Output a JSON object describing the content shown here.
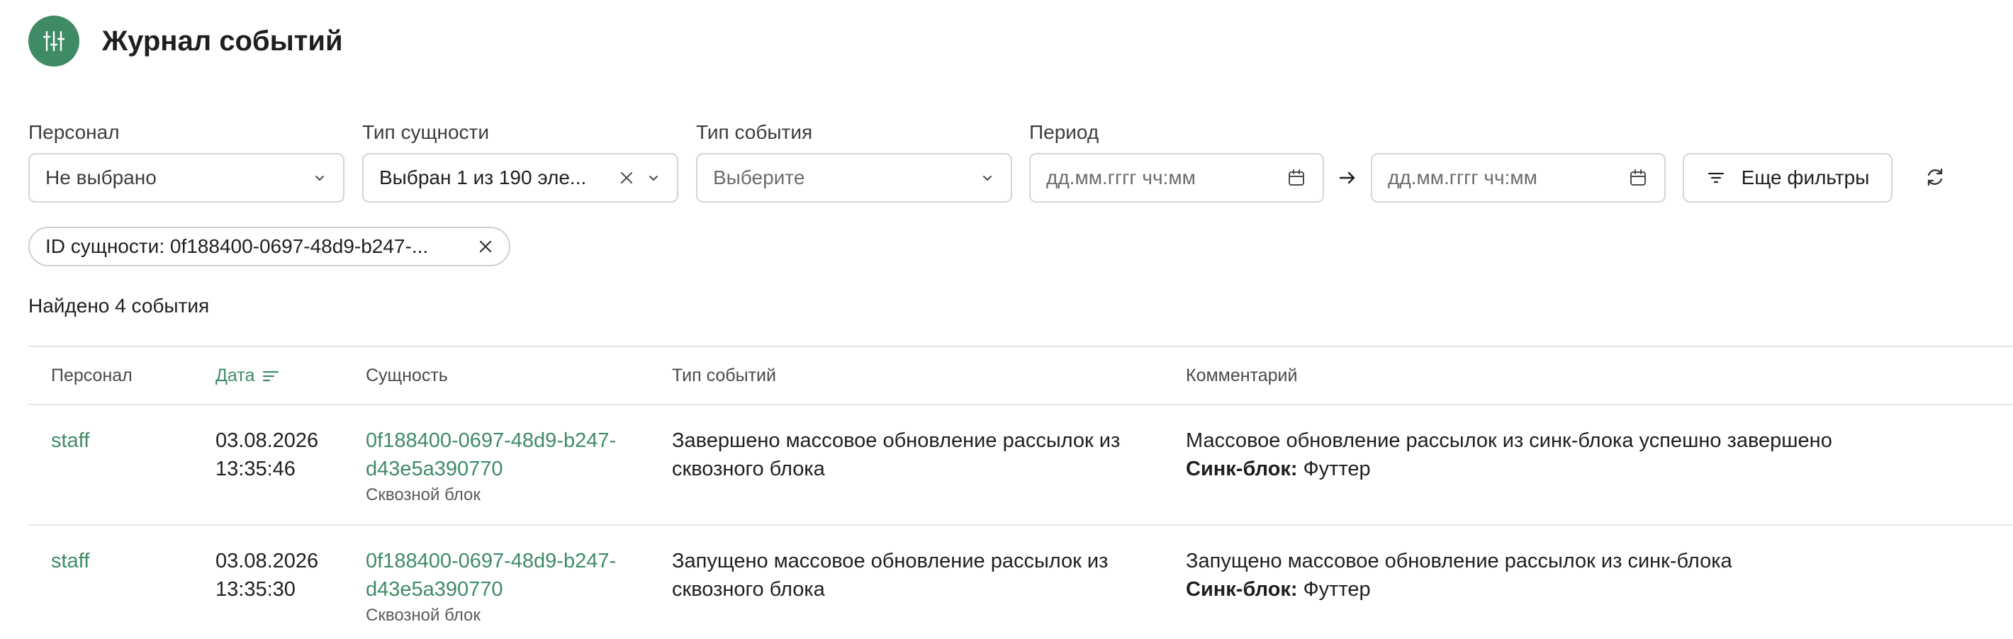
{
  "header": {
    "title": "Журнал событий",
    "icon": "sliders-icon",
    "accent": "#3f8b66"
  },
  "filters": {
    "staff": {
      "label": "Персонал",
      "value": "Не выбрано"
    },
    "entity_type": {
      "label": "Тип сущности",
      "value": "Выбран 1 из 190 эле..."
    },
    "event_type": {
      "label": "Тип события",
      "placeholder": "Выберите"
    },
    "period": {
      "label": "Период",
      "from_placeholder": "дд.мм.гггг чч:мм",
      "to_placeholder": "дд.мм.гггг чч:мм"
    },
    "more_filters": "Еще фильтры"
  },
  "chip": {
    "text": "ID сущности: 0f188400-0697-48d9-b247-..."
  },
  "found": "Найдено 4 события",
  "table": {
    "columns": [
      "Персонал",
      "Дата",
      "Сущность",
      "Тип событий",
      "Комментарий"
    ],
    "rows": [
      {
        "staff": "staff",
        "date": "03.08.2026",
        "time": "13:35:46",
        "entity_id_1": "0f188400-0697-48d9-b247-",
        "entity_id_2": "d43e5a390770",
        "entity_type": "Сквозной блок",
        "event_1": "Завершено массовое обновление рассылок из",
        "event_2": "сквозного блока",
        "comment": "Массовое обновление рассылок из синк-блока успешно завершено",
        "detail_label": "Синк-блок:",
        "detail_value": " Футтер"
      },
      {
        "staff": "staff",
        "date": "03.08.2026",
        "time": "13:35:30",
        "entity_id_1": "0f188400-0697-48d9-b247-",
        "entity_id_2": "d43e5a390770",
        "entity_type": "Сквозной блок",
        "event_1": "Запущено массовое обновление рассылок из",
        "event_2": "сквозного блока",
        "comment": "Запущено массовое обновление рассылок из синк-блока",
        "detail_label": "Синк-блок:",
        "detail_value": " Футтер"
      }
    ]
  }
}
